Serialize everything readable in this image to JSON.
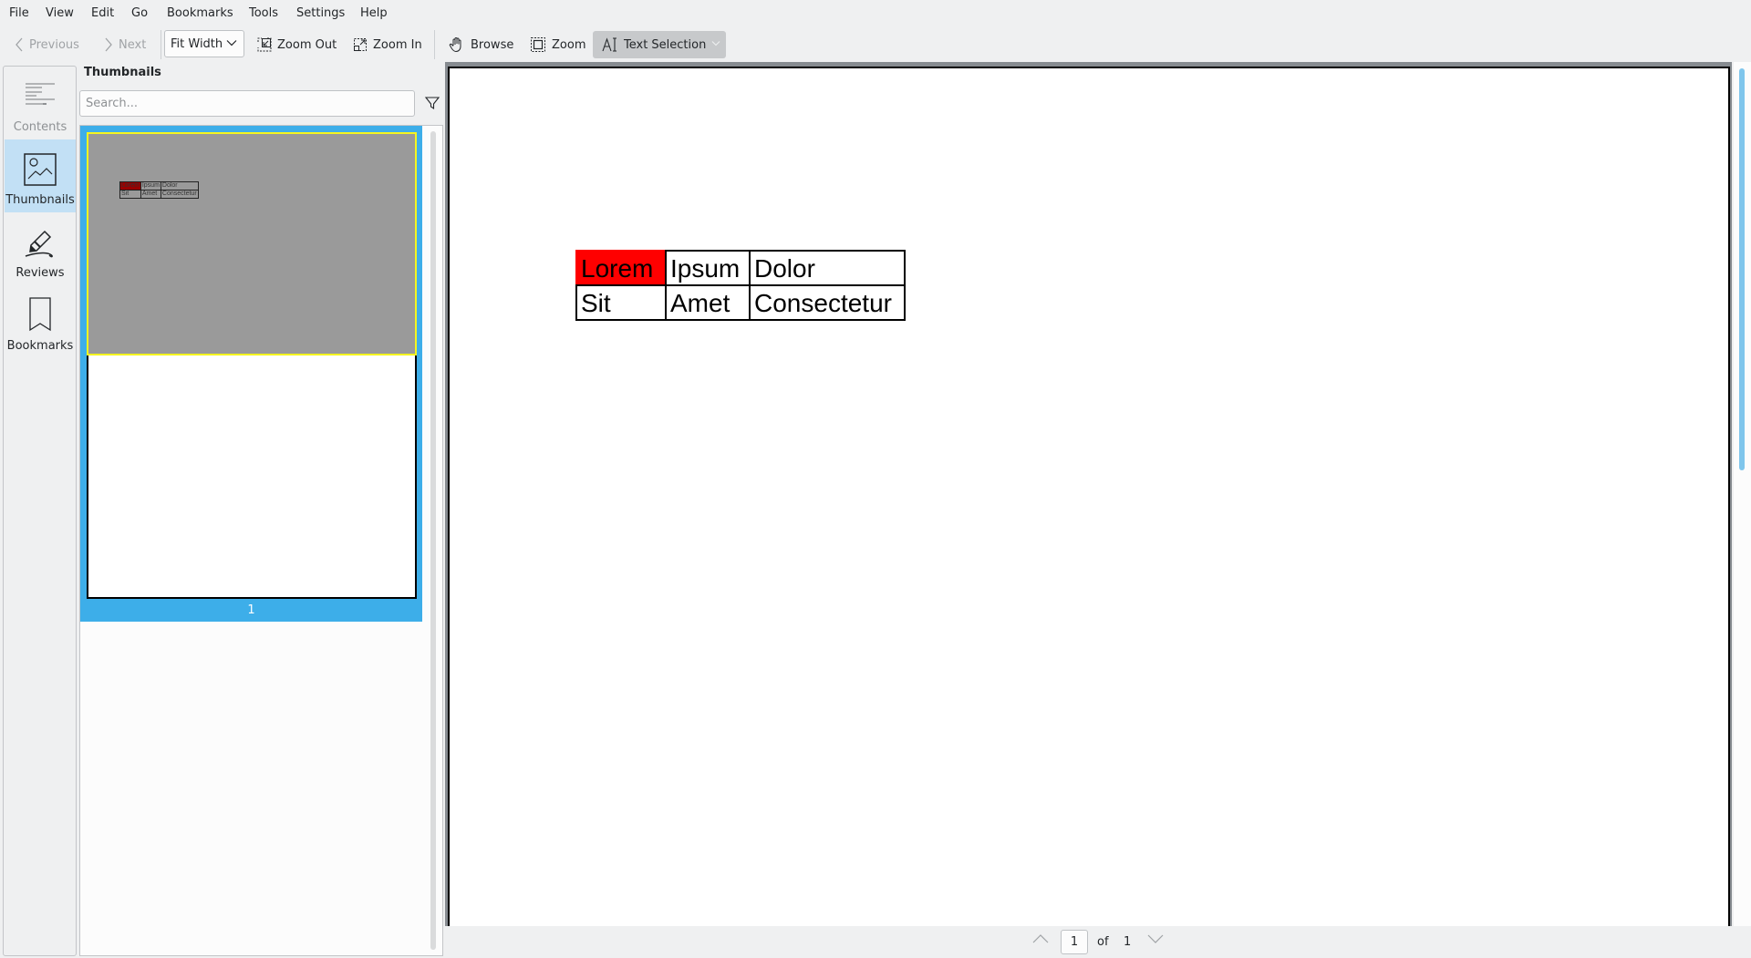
{
  "menu": [
    "File",
    "View",
    "Edit",
    "Go",
    "Bookmarks",
    "Tools",
    "Settings",
    "Help"
  ],
  "toolbar": {
    "previous_label": "Previous",
    "next_label": "Next",
    "zoom_mode": "Fit Width",
    "zoom_out_label": "Zoom Out",
    "zoom_in_label": "Zoom In",
    "browse_label": "Browse",
    "zoom_label": "Zoom",
    "text_selection_label": "Text Selection"
  },
  "sidebar": {
    "tabs": [
      {
        "label": "Contents",
        "icon": "contents-icon",
        "active": false
      },
      {
        "label": "Thumbnails",
        "icon": "thumbnails-icon",
        "active": true
      },
      {
        "label": "Reviews",
        "icon": "reviews-icon",
        "active": false
      },
      {
        "label": "Bookmarks",
        "icon": "bookmarks-icon",
        "active": false
      }
    ]
  },
  "thumbnails": {
    "title": "Thumbnails",
    "search_placeholder": "Search...",
    "items": [
      {
        "page_number": "1"
      }
    ]
  },
  "document": {
    "table": [
      [
        "Lorem",
        "Ipsum",
        "Dolor"
      ],
      [
        "Sit",
        "Amet",
        "Consectetur"
      ]
    ],
    "highlight_color": "#ff0000"
  },
  "pager": {
    "current_page": "1",
    "of_label": "of",
    "total_pages": "1"
  },
  "colors": {
    "selection": "#3daee9",
    "active_tab": "#c2e0f5",
    "scrollbar": "#7fc6ec"
  }
}
